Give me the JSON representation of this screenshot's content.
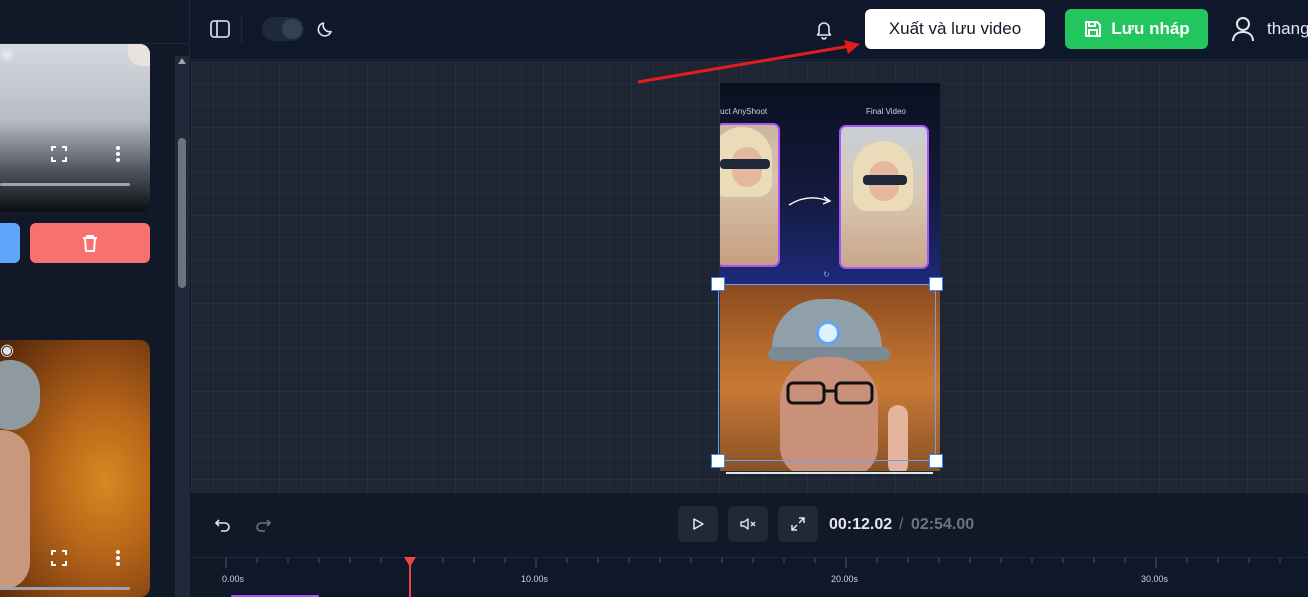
{
  "header": {
    "export_label": "Xuất và lưu video",
    "save_draft_label": "Lưu nháp",
    "username": "thang"
  },
  "canvas": {
    "top_video": {
      "left_caption": "uct AnyShoot",
      "right_caption": "Final Video"
    }
  },
  "player": {
    "current_time": "00:12.02",
    "separator": "/",
    "total_time": "02:54.00",
    "playhead_position_fraction": 0.069
  },
  "timeline": {
    "tick_labels": [
      "0.00s",
      "10.00s",
      "20.00s",
      "30.00s"
    ]
  },
  "colors": {
    "export_button_bg": "#ffffff",
    "save_draft_bg": "#22c55e",
    "delete_button_bg": "#f87171",
    "selection": "#3b82f6",
    "playhead": "#ef4444",
    "annotation_arrow": "#e11d1d"
  },
  "icons": {
    "sidebar_toggle": "sidebar-toggle-icon",
    "theme": "moon-icon",
    "notifications": "bell-icon",
    "save": "floppy-disk-icon",
    "user": "user-icon",
    "delete": "trash-icon",
    "undo": "undo-icon",
    "redo": "redo-icon",
    "play": "play-icon",
    "mute": "volume-mute-icon",
    "fullscreen": "expand-icon"
  }
}
